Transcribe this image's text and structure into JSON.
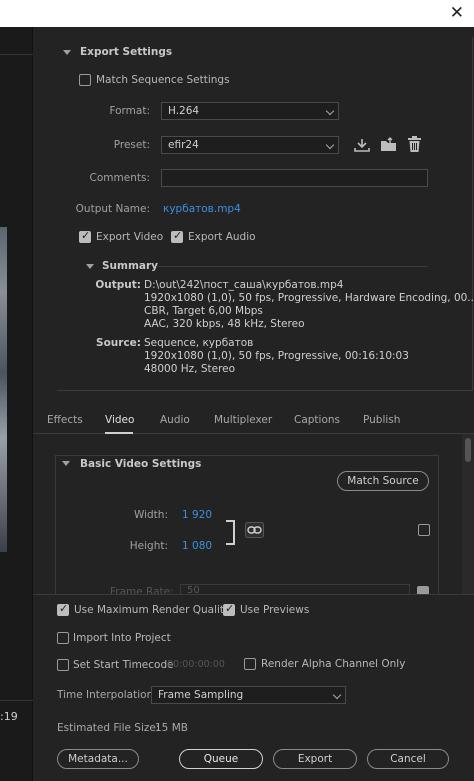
{
  "window": {
    "close_glyph": "✕"
  },
  "left_panel": {
    "timecode": ":19"
  },
  "export_settings": {
    "title": "Export Settings",
    "match_sequence_label": "Match Sequence Settings",
    "match_sequence_checked": false,
    "format_label": "Format:",
    "format_value": "H.264",
    "preset_label": "Preset:",
    "preset_value": "efir24",
    "comments_label": "Comments:",
    "comments_value": "",
    "output_name_label": "Output Name:",
    "output_name_value": "курбатов.mp4",
    "export_video_label": "Export Video",
    "export_video_checked": true,
    "export_audio_label": "Export Audio",
    "export_audio_checked": true,
    "summary": {
      "title": "Summary",
      "output_label": "Output:",
      "output_lines": [
        "D:\\out\\242\\пост_саша\\курбатов.mp4",
        "1920x1080 (1,0), 50 fps, Progressive, Hardware Encoding, 00...",
        "CBR, Target 6,00 Mbps",
        "AAC, 320 kbps, 48 kHz, Stereo"
      ],
      "source_label": "Source:",
      "source_lines": [
        "Sequence, курбатов",
        "1920x1080 (1,0), 50 fps, Progressive, 00:16:10:03",
        "48000 Hz, Stereo"
      ]
    }
  },
  "tabs": [
    {
      "label": "Effects",
      "active": false
    },
    {
      "label": "Video",
      "active": true
    },
    {
      "label": "Audio",
      "active": false
    },
    {
      "label": "Multiplexer",
      "active": false
    },
    {
      "label": "Captions",
      "active": false
    },
    {
      "label": "Publish",
      "active": false
    }
  ],
  "video_settings": {
    "title": "Basic Video Settings",
    "match_source_label": "Match Source",
    "width_label": "Width:",
    "width_value": "1 920",
    "height_label": "Height:",
    "height_value": "1 080",
    "frame_rate_label": "Frame Rate:",
    "frame_rate_value": "50"
  },
  "bottom": {
    "max_render_label": "Use Maximum Render Quality",
    "max_render_checked": true,
    "use_previews_label": "Use Previews",
    "use_previews_checked": true,
    "import_label": "Import Into Project",
    "import_checked": false,
    "start_tc_label": "Set Start Timecode",
    "start_tc_checked": false,
    "start_tc_value": "00:00:00:00",
    "alpha_label": "Render Alpha Channel Only",
    "alpha_checked": false,
    "interp_label": "Time Interpolation:",
    "interp_value": "Frame Sampling",
    "file_size_label": "Estimated File Size:",
    "file_size_value": "15 MB",
    "buttons": {
      "metadata": "Metadata...",
      "queue": "Queue",
      "export": "Export",
      "cancel": "Cancel"
    }
  }
}
